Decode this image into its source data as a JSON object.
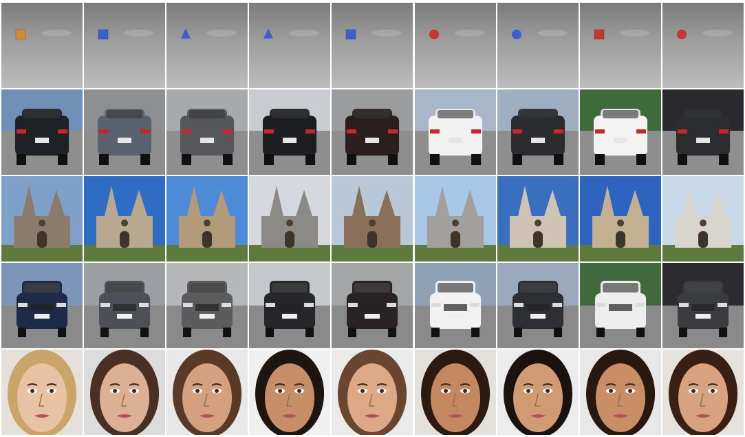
{
  "figure": {
    "columns": 9,
    "rows": [
      {
        "id": "synthetic-objects",
        "cells": [
          {
            "object": "cube",
            "color": "#d4892e"
          },
          {
            "object": "cube",
            "color": "#3a5fcf"
          },
          {
            "object": "cone",
            "color": "#3a5fcf"
          },
          {
            "object": "cone",
            "color": "#3a5fcf"
          },
          {
            "object": "cube",
            "color": "#3a5fcf"
          },
          {
            "object": "sphere",
            "color": "#c93434"
          },
          {
            "object": "sphere",
            "color": "#3a5fcf"
          },
          {
            "object": "cube",
            "color": "#c93434"
          },
          {
            "object": "sphere",
            "color": "#c93434"
          }
        ]
      },
      {
        "id": "car-rear-views",
        "cells": [
          {
            "body": "#1e2126",
            "bg": "#6f8fb6"
          },
          {
            "body": "#5a6270",
            "bg": "#8d8f92"
          },
          {
            "body": "#55575b",
            "bg": "#a7a9ac"
          },
          {
            "body": "#1c1e22",
            "bg": "#c9cdd1"
          },
          {
            "body": "#2a1e1e",
            "bg": "#9a9c9e"
          },
          {
            "body": "#f1f1f1",
            "bg": "#a8b7c7"
          },
          {
            "body": "#2a2c30",
            "bg": "#9eafc2"
          },
          {
            "body": "#f3f3f3",
            "bg": "#3f6b3a"
          },
          {
            "body": "#2b2d31",
            "bg": "#2a2a2e"
          }
        ]
      },
      {
        "id": "churches",
        "cells": [
          {
            "stone": "#8a7b6b",
            "sky": "#7fa0c8"
          },
          {
            "stone": "#b8a88f",
            "sky": "#2f6cc4"
          },
          {
            "stone": "#b39a7a",
            "sky": "#4d8bd6"
          },
          {
            "stone": "#8c8a86",
            "sky": "#d5d9df"
          },
          {
            "stone": "#8a7058",
            "sky": "#b9c8d8"
          },
          {
            "stone": "#a2a09c",
            "sky": "#a8c6e6"
          },
          {
            "stone": "#cfc4b4",
            "sky": "#3a6fc0"
          },
          {
            "stone": "#c2b090",
            "sky": "#2e64c0"
          },
          {
            "stone": "#d8d4ce",
            "sky": "#c9d9ea"
          }
        ]
      },
      {
        "id": "car-front-views",
        "cells": [
          {
            "body": "#1d2a48",
            "bg": "#7c95b8"
          },
          {
            "body": "#4d5057",
            "bg": "#9b9ea2"
          },
          {
            "body": "#5b5c5e",
            "bg": "#b5b7b9"
          },
          {
            "body": "#25272b",
            "bg": "#c4c8cc"
          },
          {
            "body": "#2a2324",
            "bg": "#a3a5a7"
          },
          {
            "body": "#f2f2f2",
            "bg": "#8fa1b5"
          },
          {
            "body": "#2d2f34",
            "bg": "#9aaabc"
          },
          {
            "body": "#eeeeee",
            "bg": "#41693d"
          },
          {
            "body": "#3a3c40",
            "bg": "#2c2c30"
          }
        ]
      },
      {
        "id": "faces",
        "cells": [
          {
            "hair": "#c9a56a",
            "skin": "#e8c2a4",
            "bg": "#e6e0da"
          },
          {
            "hair": "#4a3024",
            "skin": "#dcb094",
            "bg": "#dcdcdc"
          },
          {
            "hair": "#5a3a26",
            "skin": "#d4a07e",
            "bg": "#e8e8e8"
          },
          {
            "hair": "#1e1410",
            "skin": "#c88e68",
            "bg": "#f0f0f0"
          },
          {
            "hair": "#6a4630",
            "skin": "#dca886",
            "bg": "#eaeaea"
          },
          {
            "hair": "#2a1a12",
            "skin": "#c48860",
            "bg": "#e4e0dc"
          },
          {
            "hair": "#1a120e",
            "skin": "#d09a72",
            "bg": "#ececec"
          },
          {
            "hair": "#281810",
            "skin": "#c98e66",
            "bg": "#e8e8e8"
          },
          {
            "hair": "#3a2014",
            "skin": "#d8a27e",
            "bg": "#e6e2de"
          }
        ]
      }
    ]
  }
}
